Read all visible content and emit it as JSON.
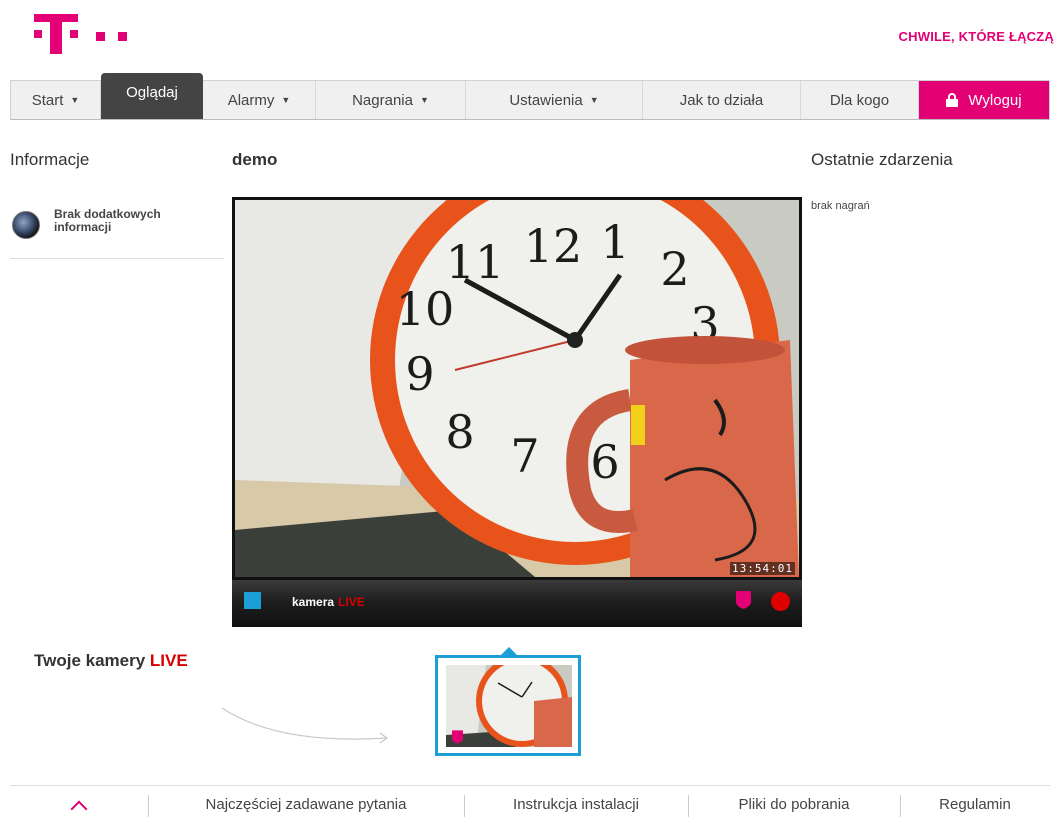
{
  "header": {
    "slogan": "CHWILE, KTÓRE ŁĄCZĄ",
    "brand_color": "#e20074"
  },
  "nav": {
    "items": [
      {
        "label": "Start",
        "has_dropdown": true
      },
      {
        "label": "Oglądaj",
        "active": true
      },
      {
        "label": "Alarmy",
        "has_dropdown": true
      },
      {
        "label": "Nagrania",
        "has_dropdown": true
      },
      {
        "label": "Ustawienia",
        "has_dropdown": true
      },
      {
        "label": "Jak to działa"
      },
      {
        "label": "Dla kogo"
      },
      {
        "label": "Wyloguj",
        "icon": "lock-icon"
      }
    ],
    "dropdown_caret": "▼"
  },
  "left": {
    "title": "Informacje",
    "info_text": "Brak dodatkowych informacji"
  },
  "center": {
    "title": "demo",
    "video": {
      "timestamp": "13:54:01",
      "camera_name": "kamera",
      "live_label": "LIVE"
    }
  },
  "right": {
    "title": "Ostatnie zdarzenia",
    "empty_text": "brak nagrań"
  },
  "cameras": {
    "title": "Twoje kamery",
    "live_label": "LIVE"
  },
  "footer": {
    "items": [
      "Najczęściej zadawane pytania",
      "Instrukcja instalacji",
      "Pliki do pobrania",
      "Regulamin"
    ]
  },
  "colors": {
    "accent_blue": "#1b9fd6",
    "live_red": "#d70000",
    "record_red": "#e00000"
  }
}
